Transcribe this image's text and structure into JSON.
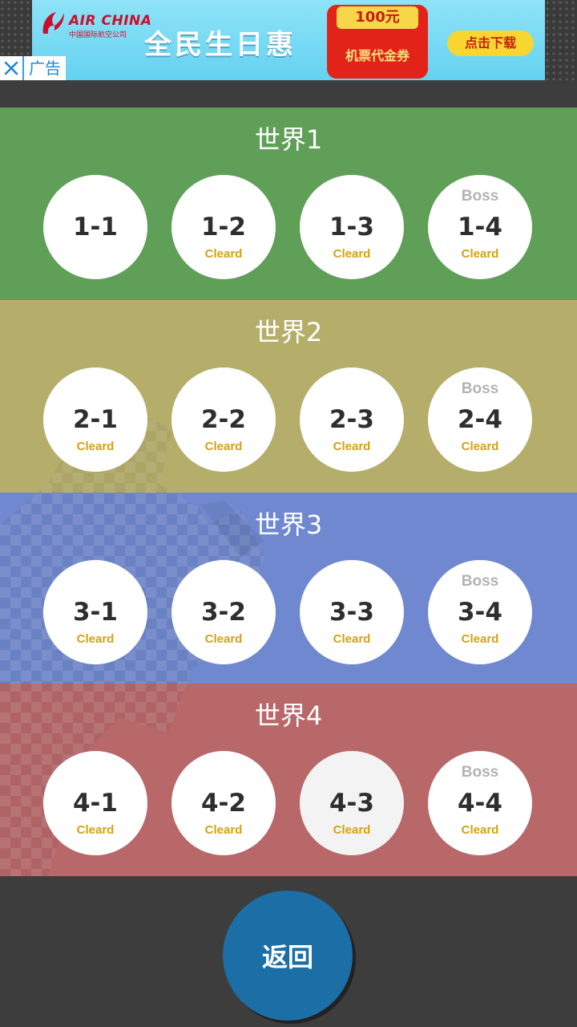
{
  "ad": {
    "brand": "AIR CHINA",
    "brand_sub": "中国国际航空公司",
    "slogan": "全民生日惠",
    "coupon_amount": "100元",
    "coupon_text": "机票代金券",
    "cta": "点击下载",
    "label": "广告",
    "close_icon": "close-icon"
  },
  "colors": {
    "world1": "#5f9f57",
    "world2": "#b5ae6b",
    "world3": "#7088cf",
    "world4": "#b9686a",
    "level_text": "#2e2e2e",
    "cleared": "#d4a20f",
    "boss": "#b3b3b3",
    "back_button": "#1b6fa6"
  },
  "worlds": [
    {
      "title": "世界1",
      "levels": [
        {
          "num": "1-1",
          "boss": "",
          "status": ""
        },
        {
          "num": "1-2",
          "boss": "",
          "status": "Cleard"
        },
        {
          "num": "1-3",
          "boss": "",
          "status": "Cleard"
        },
        {
          "num": "1-4",
          "boss": "Boss",
          "status": "Cleard"
        }
      ]
    },
    {
      "title": "世界2",
      "levels": [
        {
          "num": "2-1",
          "boss": "",
          "status": "Cleard"
        },
        {
          "num": "2-2",
          "boss": "",
          "status": "Cleard"
        },
        {
          "num": "2-3",
          "boss": "",
          "status": "Cleard"
        },
        {
          "num": "2-4",
          "boss": "Boss",
          "status": "Cleard"
        }
      ]
    },
    {
      "title": "世界3",
      "levels": [
        {
          "num": "3-1",
          "boss": "",
          "status": "Cleard"
        },
        {
          "num": "3-2",
          "boss": "",
          "status": "Cleard"
        },
        {
          "num": "3-3",
          "boss": "",
          "status": "Cleard"
        },
        {
          "num": "3-4",
          "boss": "Boss",
          "status": "Cleard"
        }
      ]
    },
    {
      "title": "世界4",
      "levels": [
        {
          "num": "4-1",
          "boss": "",
          "status": "Cleard"
        },
        {
          "num": "4-2",
          "boss": "",
          "status": "Cleard"
        },
        {
          "num": "4-3",
          "boss": "",
          "status": "Cleard"
        },
        {
          "num": "4-4",
          "boss": "Boss",
          "status": "Cleard"
        }
      ]
    }
  ],
  "back_label": "返回"
}
